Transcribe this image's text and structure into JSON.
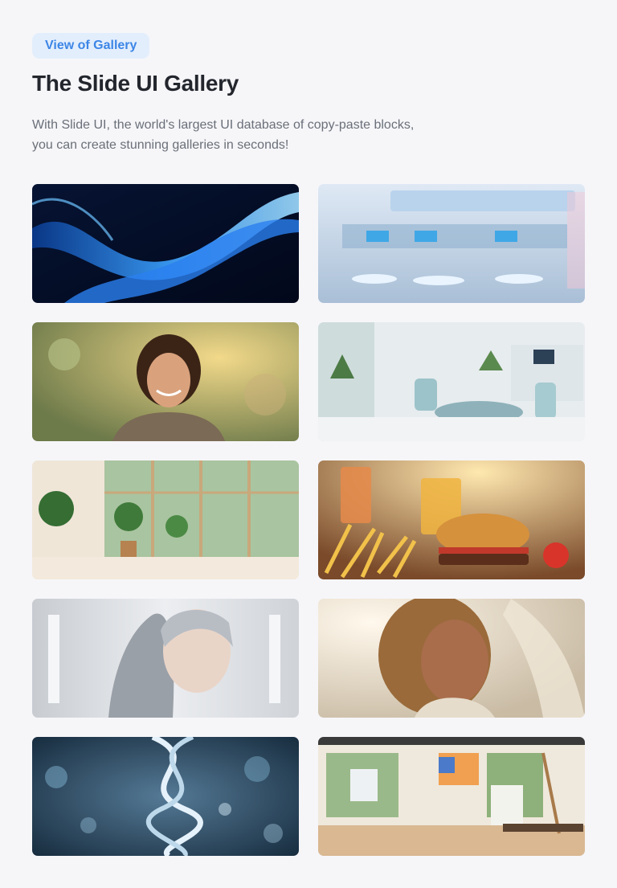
{
  "header": {
    "badge_label": "View of Gallery",
    "title": "The Slide UI Gallery",
    "description_line1": "With Slide UI, the world's largest UI database of copy-paste blocks,",
    "description_line2": "you can create stunning galleries in seconds!"
  },
  "gallery": {
    "items": [
      {
        "name": "abstract-blue-waves-image"
      },
      {
        "name": "futuristic-lab-image"
      },
      {
        "name": "smiling-man-portrait-image"
      },
      {
        "name": "dental-clinic-interior-image"
      },
      {
        "name": "room-with-plants-image"
      },
      {
        "name": "burger-and-fries-image"
      },
      {
        "name": "robot-woman-image"
      },
      {
        "name": "woman-portrait-image"
      },
      {
        "name": "dna-helix-image"
      },
      {
        "name": "art-studio-image"
      }
    ]
  }
}
